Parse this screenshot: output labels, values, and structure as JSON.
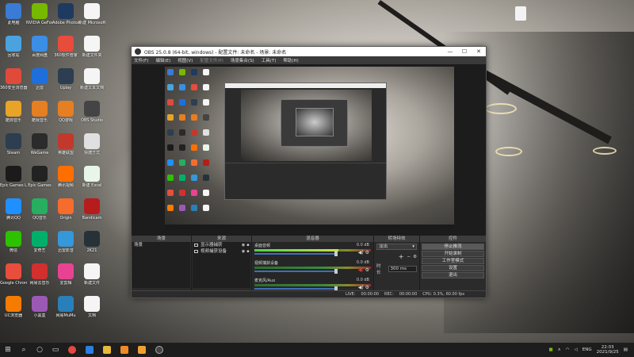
{
  "desktop": {
    "icons_col1": [
      "此电脑",
      "回收站",
      "360安全浏览器",
      "酷狗音乐",
      "Steam",
      "Epic Games Launcher",
      "腾讯QQ",
      "微信",
      "Google Chrome",
      "UC浏览器"
    ],
    "icons_col2": [
      "NVIDIA GeForce Experience",
      "百度网盘",
      "迅雷",
      "酷我音乐",
      "WeGame",
      "Epic Games",
      "QQ音乐",
      "爱奇艺",
      "网易云音乐",
      "小黑盒"
    ],
    "icons_col3": [
      "Adobe Photoshop",
      "360软件管家",
      "Uplay",
      "QQ游戏",
      "英雄联盟",
      "腾讯视频",
      "Origin",
      "迅雷影音",
      "爱剪辑",
      "网易MuMu"
    ],
    "icons_col4": [
      "新建 Microsoft",
      "新建文件夹",
      "新建文本文档",
      "OBS Studio",
      "快捷方式",
      "新建 Excel",
      "Bandicam",
      "2K21",
      "新建文件",
      "文档"
    ]
  },
  "obs": {
    "title": "OBS 25.0.8 (64-bit, windows) - 配置文件: 未命名 - 场景: 未命名",
    "menu": [
      "文件(F)",
      "编辑(E)",
      "视图(V)",
      "配置文件(P)",
      "场景集合(S)",
      "工具(T)",
      "帮助(H)"
    ],
    "scenes": {
      "header": "场景",
      "items": [
        "场景"
      ],
      "footer": "+ − ∧ ∨"
    },
    "sources": {
      "header": "来源",
      "items": [
        "显示器捕获",
        "视频捕获设备"
      ],
      "footer": "+ − ⚙ ∧ ∨"
    },
    "mixer": {
      "header": "混音器",
      "items": [
        {
          "name": "桌面音频",
          "db": "0.0 dB",
          "level": 0.72
        },
        {
          "name": "视频捕获设备",
          "db": "0.0 dB",
          "level": 0.0
        },
        {
          "name": "麦克风/Aux",
          "db": "0.0 dB",
          "level": 0.0
        }
      ]
    },
    "transitions": {
      "header": "转场特效",
      "selected": "淡出",
      "duration_label": "时长",
      "duration_value": "300 ms"
    },
    "controls": {
      "header": "控件",
      "buttons": [
        "停止推流",
        "开始录制",
        "工作室模式",
        "设置",
        "退出"
      ]
    },
    "status": {
      "live_label": "LIVE:",
      "live_time": "00:00:00",
      "rec_label": "REC:",
      "rec_time": "00:00:00",
      "cpu": "CPU: 0.3%, 60.00 fps"
    }
  },
  "taskbar": {
    "lang": "ENG",
    "time": "22:03",
    "date": "2021/9/25"
  }
}
